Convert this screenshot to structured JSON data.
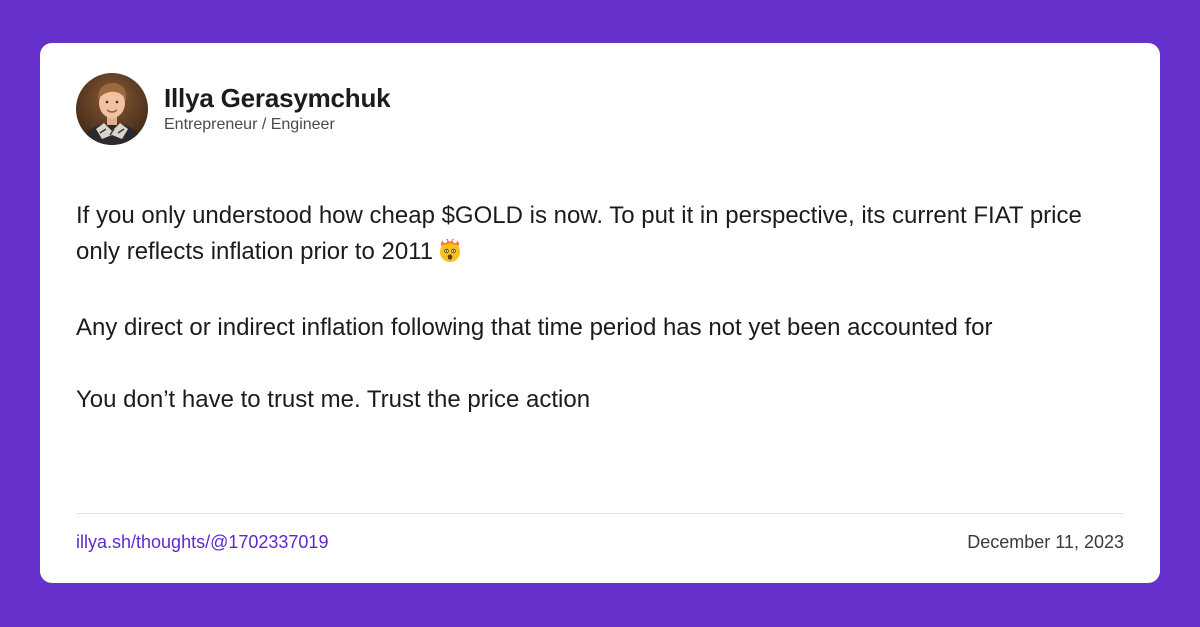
{
  "author": {
    "name": "Illya Gerasymchuk",
    "role": "Entrepreneur / Engineer"
  },
  "post": {
    "paragraph_1": "If you only understood how cheap $GOLD is now. To put it in perspective, its current FIAT price only reflects inflation prior to 2011",
    "paragraph_1_emoji": "exploding-head-emoji",
    "paragraph_2": "Any direct or indirect inflation following that time period has not yet been accounted for",
    "paragraph_3": "You don’t have to trust me. Trust the price action"
  },
  "footer": {
    "link": "illya.sh/thoughts/@1702337019",
    "date": "December 11, 2023"
  },
  "colors": {
    "background": "#6631cc",
    "card": "#ffffff",
    "link": "#5b2ad0",
    "text": "#1c1c1e"
  }
}
